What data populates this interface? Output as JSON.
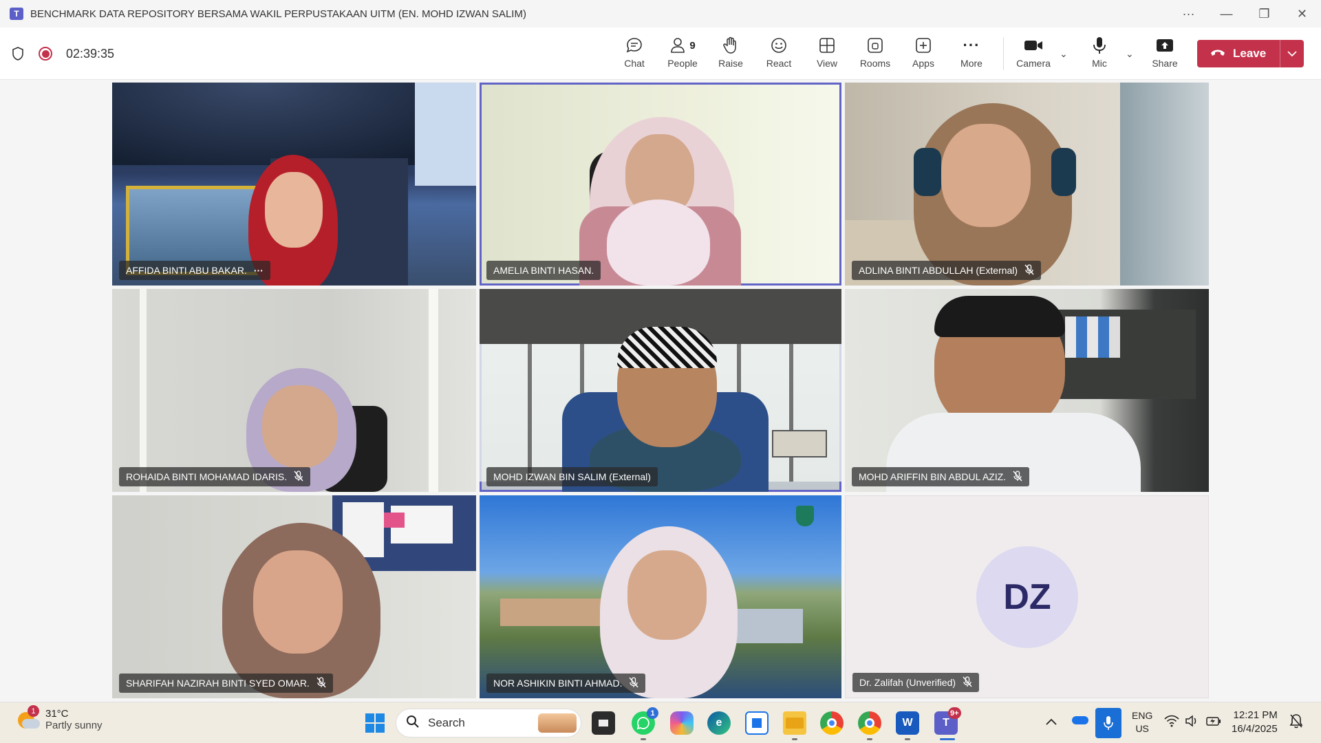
{
  "window": {
    "title": "BENCHMARK DATA REPOSITORY BERSAMA WAKIL PERPUSTAKAAN UITM (EN. MOHD IZWAN SALIM)",
    "controls": [
      "more-icon",
      "minimize-icon",
      "restore-icon",
      "close-icon"
    ]
  },
  "meeting": {
    "timer": "02:39:35",
    "people_count": "9",
    "toolbar": {
      "chat": "Chat",
      "people": "People",
      "raise": "Raise",
      "react": "React",
      "view": "View",
      "rooms": "Rooms",
      "apps": "Apps",
      "more": "More",
      "camera": "Camera",
      "mic": "Mic",
      "share": "Share",
      "leave": "Leave"
    },
    "accent": "#c4314b",
    "active_speaker_color": "#6264c5"
  },
  "participants": [
    {
      "name": "AFFIDA BINTI ABU BAKAR.",
      "muted": false,
      "extra": "···"
    },
    {
      "name": "AMELIA BINTI HASAN.",
      "muted": false
    },
    {
      "name": "ADLINA BINTI ABDULLAH (External)",
      "muted": true
    },
    {
      "name": "ROHAIDA BINTI MOHAMAD IDARIS.",
      "muted": true
    },
    {
      "name": "MOHD IZWAN BIN SALIM (External)",
      "muted": false,
      "speaking": true
    },
    {
      "name": "MOHD ARIFFIN BIN ABDUL AZIZ.",
      "muted": true
    },
    {
      "name": "SHARIFAH NAZIRAH BINTI SYED OMAR.",
      "muted": true
    },
    {
      "name": "NOR ASHIKIN BINTI AHMAD.",
      "muted": true
    },
    {
      "name": "Dr. Zalifah (Unverified)",
      "muted": true,
      "initials": "DZ"
    }
  ],
  "taskbar": {
    "weather": {
      "temp": "31°C",
      "condition": "Partly sunny",
      "badge": "1"
    },
    "search_placeholder": "Search",
    "whatsapp_badge": "1",
    "teams_badge": "9+",
    "lang": {
      "line1": "ENG",
      "line2": "US"
    },
    "clock": {
      "time": "12:21 PM",
      "date": "16/4/2025"
    }
  }
}
